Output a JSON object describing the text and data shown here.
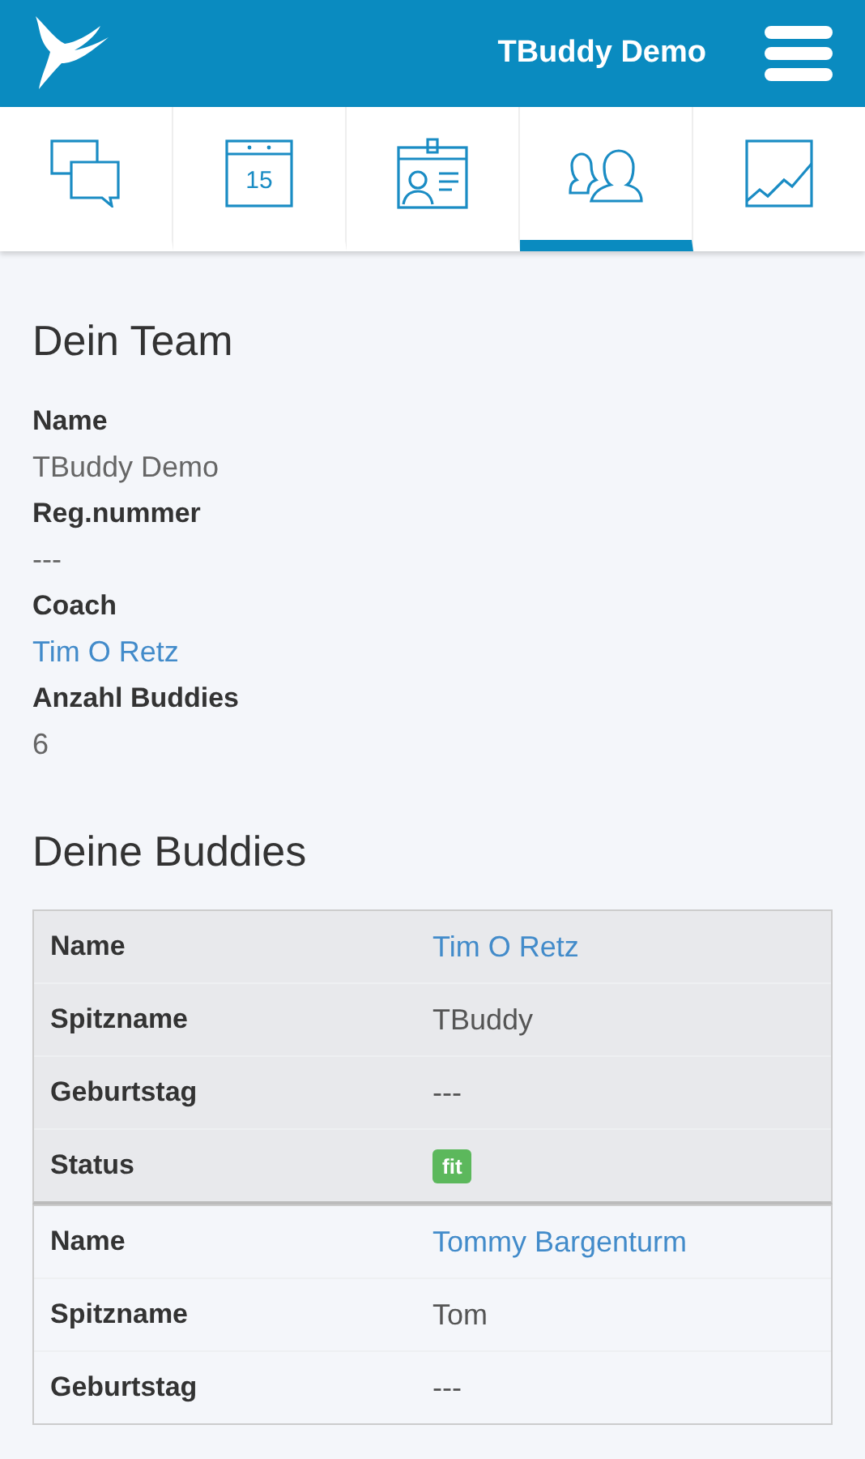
{
  "header": {
    "title": "TBuddy Demo"
  },
  "tabs": [
    {
      "kind": "chat",
      "selected": false
    },
    {
      "kind": "calendar",
      "label": "15",
      "selected": false
    },
    {
      "kind": "contact",
      "selected": false
    },
    {
      "kind": "team",
      "selected": true
    },
    {
      "kind": "chart",
      "selected": false
    }
  ],
  "team": {
    "heading": "Dein Team",
    "fields": [
      {
        "label": "Name",
        "value": "TBuddy Demo",
        "kind": "text"
      },
      {
        "label": "Reg.nummer",
        "value": "---",
        "kind": "text"
      },
      {
        "label": "Coach",
        "value": "Tim O Retz",
        "kind": "link"
      },
      {
        "label": "Anzahl Buddies",
        "value": "6",
        "kind": "text"
      }
    ]
  },
  "buddies": {
    "heading": "Deine Buddies",
    "items": [
      {
        "selected": true,
        "rows": [
          {
            "label": "Name",
            "value": "Tim O Retz",
            "kind": "link"
          },
          {
            "label": "Spitzname",
            "value": "TBuddy",
            "kind": "text"
          },
          {
            "label": "Geburtstag",
            "value": "---",
            "kind": "text"
          },
          {
            "label": "Status",
            "value": "fit",
            "kind": "badge"
          }
        ]
      },
      {
        "selected": false,
        "rows": [
          {
            "label": "Name",
            "value": "Tommy Bargenturm",
            "kind": "link"
          },
          {
            "label": "Spitzname",
            "value": "Tom",
            "kind": "text"
          },
          {
            "label": "Geburtstag",
            "value": "---",
            "kind": "text"
          }
        ]
      }
    ]
  }
}
